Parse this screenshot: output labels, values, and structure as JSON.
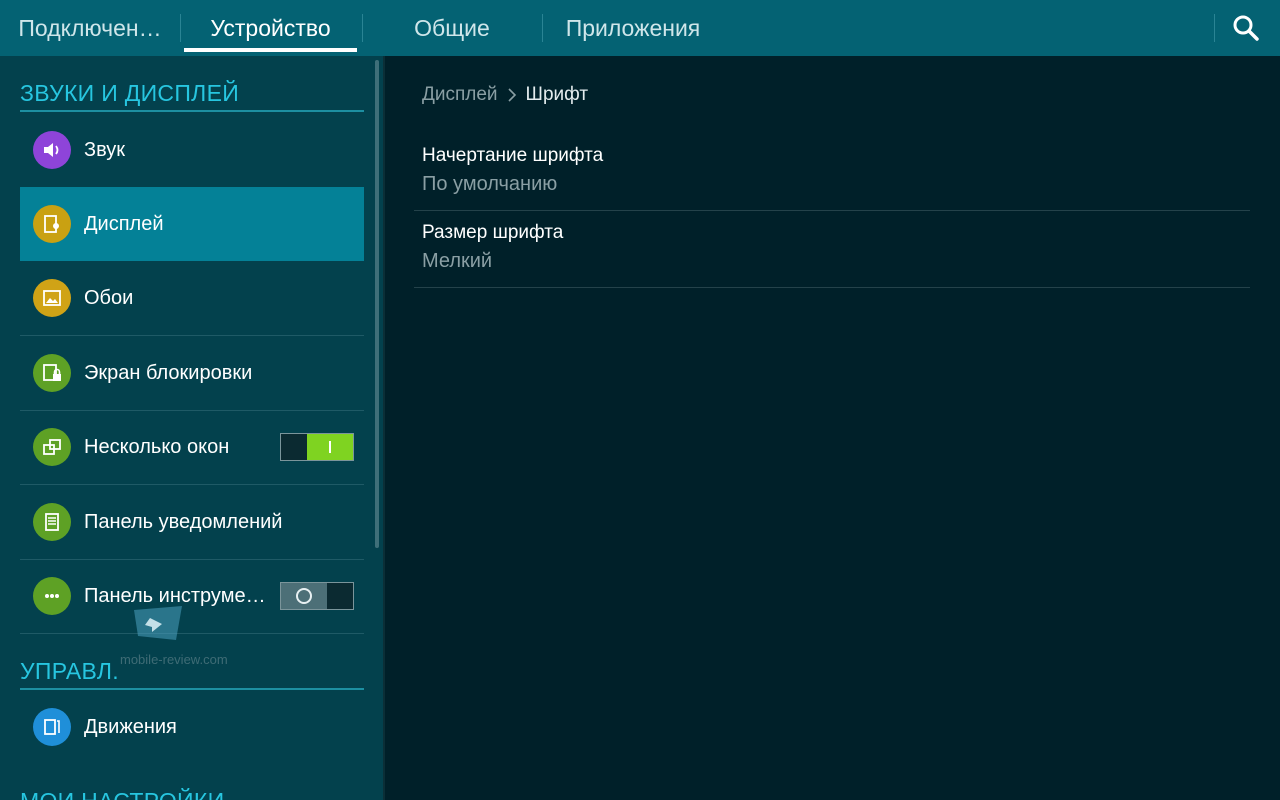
{
  "tabs": [
    {
      "label": "Подключен…"
    },
    {
      "label": "Устройство"
    },
    {
      "label": "Общие"
    },
    {
      "label": "Приложения"
    }
  ],
  "sections": [
    {
      "title": "ЗВУКИ И ДИСПЛЕЙ"
    },
    {
      "title": "УПРАВЛ."
    },
    {
      "title": "МОИ НАСТРОЙКИ"
    }
  ],
  "items": [
    {
      "label": "Звук",
      "icon": "speaker-icon",
      "color": "#8e44d9"
    },
    {
      "label": "Дисплей",
      "icon": "display-icon",
      "color": "#c9a112"
    },
    {
      "label": "Обои",
      "icon": "wallpaper-icon",
      "color": "#d0a316"
    },
    {
      "label": "Экран блокировки",
      "icon": "lock-screen-icon",
      "color": "#5ea125"
    },
    {
      "label": "Несколько окон",
      "icon": "multi-window-icon",
      "color": "#5ea125",
      "toggle": "on"
    },
    {
      "label": "Панель уведомлений",
      "icon": "notification-panel-icon",
      "color": "#5ea125"
    },
    {
      "label": "Панель инструме…",
      "icon": "toolbox-icon",
      "color": "#5ea125",
      "toggle": "off"
    },
    {
      "label": "Движения",
      "icon": "motion-icon",
      "color": "#1f8fd9"
    }
  ],
  "breadcrumb": {
    "parent": "Дисплей",
    "current": "Шрифт"
  },
  "settings": [
    {
      "title": "Начертание шрифта",
      "value": "По умолчанию"
    },
    {
      "title": "Размер шрифта",
      "value": "Мелкий"
    }
  ],
  "watermark": "mobile-review.com",
  "colors": {
    "topbar": "#046273",
    "accent": "#27c6e0",
    "selected": "#048197",
    "toggle_on": "#7fd321"
  }
}
